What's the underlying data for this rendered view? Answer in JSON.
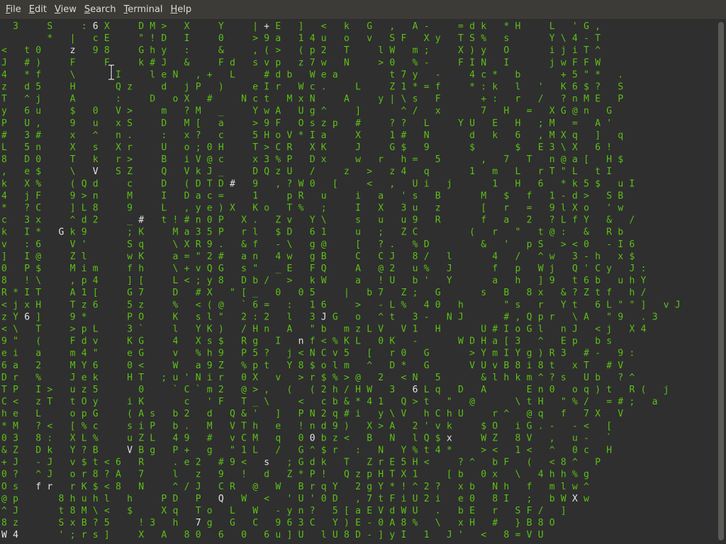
{
  "menu": [
    {
      "label": "File",
      "mnemonic": "F",
      "rest": "ile"
    },
    {
      "label": "Edit",
      "mnemonic": "E",
      "rest": "dit"
    },
    {
      "label": "View",
      "mnemonic": "V",
      "rest": "iew"
    },
    {
      "label": "Search",
      "mnemonic": "S",
      "rest": "earch"
    },
    {
      "label": "Terminal",
      "mnemonic": "T",
      "rest": "erminal"
    },
    {
      "label": "Help",
      "mnemonic": "H",
      "rest": "elp"
    }
  ],
  "colors": {
    "background": "#2f2f2f",
    "menubar": "#3c3b37",
    "menu_text": "#dfdbd2",
    "rain_green": "#5cc016",
    "rain_head": "#e6e6e6"
  },
  "terminal": {
    "program": "matrix rain",
    "rows": [
      "  3     S     : 6 X     D M >   X     Y     | + E   ]   <   k   G   ,   A -     = d k   * H     L   ' G ,  ",
      "        *   |   c E     \" ! D   I     0     > 9 a   1 4 u   o   v   S F   X y   T S %   s       Y \\ 4 - T  ",
      "<   t 0     z   9 8     G h y   :     &     , ( >   ( p 2   T     l W   m ;     X ) y   O       i j i T ^  ",
      "J   # )     F     F     k # J   &     F d   s v p   z 7 w   N     > 0   % -     F I N   I       j w F F W  ",
      "4   * f     \\       I     l e N   , +   L     # d b   W e a         t 7 y   -     4 c *   b       + 5 \" *   . ",
      "z   d 5     H       Q z     d   j P   )     e I r   W c .     L     Z 1 * = f     * : k   l   '   K 6 $ ?   S ",
      "T   ^ j     A       :     D   o X   #     N c t   M x N     A     y | \\ s   F       + :   r   /   ? n M E   P ",
      "y   6 u     $   0   V >     m   ? M   _     Y w A   U g ^     ]       ^ /   x       7   H   =   X G @ n   G ",
      "P   U ,     9   u   x S     D   M [   a     > 9 F   O s z p   #     ? ?   L     Y U   E   H   ; M   =   A ' ",
      "#   3 #     x   ^   n .     :   x ?   c     5 H o V * I a     X     1 #   N       d   k   6   , M X q   ]   q ",
      "L   5 n     X   s   X r     U   o ; 0 H     T > C R   X K     J     G $   9       $       $   E 3 \\ X   6 ! ",
      "8   D 0     T   k   r >     B   i V @ c     x 3 % P   D x     w   r   h =   5       ,   7   T   n @ a [   H $ ",
      ",   e $     \\   V   S Z     Q   V k J _     D Q z U   /     z   >   z 4   q       1   m   L   r T \" L   t I ",
      "k   X %     ( Q d     c     D   ( D T D #   9   , ? W 0   [     <   ,   U i   j       1   H   6   * k 5 $   u I ",
      "4   j F     9 > n     M     I   D a c =     1     p R   u     i   a   ' s   B       M   $   f   1 - d >   S B ",
      "*   ? C     ] L 8     9     L   , y e ) X   K o   T %   ;     I   X   3 u   z       [   r   =   9 l X o   ' w ",
      "c   3 x     ^ d 2     _ #   t ! # n 0 P   X .   Z v   Y \\     s   u   u 9   R       f   a   2   ? L f Y   &   / ",
      "k   I *   G k 9       ; K     M a 3 5 P   r l   $ D   6 1     u   ;   Z C         (   r   \"   t @ :   &   R b ",
      "v   : 6     V '       S q     \\ X R 9 .   & f   - \\   g @     [   ? .   % D         &   '   p S   > < 0   - I 6 ",
      "]   I @     Z l       w K     a = \" 2 #   a n   4 w   g B     C   C J   8 /   l       4   /   ^ w   3 - h   x $ ",
      "0   P $     M i m     f h     \\ + v Q G   s \"   _ E   F Q     A   @ 2   u %   J       f   p   W j   Q ' C y   J : ",
      "8   ! \\     , p 4     ] [     L < ; y 8   D b /   >   k W     a   ! U   b '   Y       a   h   ] 9   t 6 b   u h Y ",
      "R * I T     A 1 [     G 7     D   # X   \" [ _   0   0 5     |   b 7   Z ;   G       s   B   8 x   & ? Z t f   h / ",
      "< j x H     T z 6     5 z     %   < ( @   ` 6 =   :   1 6     >   - L %   4 0   h       \" s   r   Y t   6 L \" \" ]   v J ",
      "z Y 6 ]     9 *       P O     K   s l \"   2 : 2   l   3 J G   o   ^ t   3 -   N J       # , Q p r   \\ A   \" 9   . 3 ",
      "< \\   T     > p L     3 `     l   Y K )   / H n   A   \" b   m z L V   V 1   H       U # I o G l   n J   < j   X 4 ",
      "9 \"   (     F d v     K G     4   X s $   R g   I   n f < % K L   0 K   -       W D H a [ 3   ^   E p   b s ",
      "e i   a     m 4 \"     e G     v   % h 9   P 5 ?   j < N C v 5   [   r 0   G       > Y m I Y g ) R 3   # -   9 : ",
      "6 a   2     M Y 6     0 <     W   a 9 Z   % p t   Y 8 $ o l m   ^   D *   G       V U v B 8 i 8 t   x T   # V ",
      "D r   %     J e k     H T   ; u ' N i r   0 X   v   > r $ % > @   2   < N   5       & l h k m ^ ? s   U b   ? ^ ",
      "T P   I >   u z 5       0     ` C ` m 2   @ > ,   (   ( 2 h / H W   3   6 L q   D   A       E n 0   o q ) t   R (   j ",
      "C <   z T   t O y     i K       c   ' F   T _ \\     <   c b & * 4 1   Q > t   \"   @       \\ t H   \" % /   = # ;   a ",
      "h e   L     o p G     ( A s   b 2   d   Q & '   ]   P N 2 q # i   y \\ V   h C h U     r ^   @ q   f   7 X   V ",
      "* M   ? <   [ % c     s i P   b .   M   V T h   e   ! n d 9 )   X > A   2 ' v k     $ O   i G . -   - <   [ ",
      "0 3   8 :   X L %     u Z L   4 9   #   v C M   q   0 0 b z <   B   N   l Q $ x     W Z   8 V   ,   u -   ` ",
      "& Z   D k   Y ? B     V B g   P +   g   \" 1 L   /   G ^ $ r   :   N   Y % t 4 *     > <   1 <   ^   0 c   H ",
      "+ J   - J   v $ t < 6   R     . e 2   # 9 <   s   ; G d k   T   Z r E 5 H <     ? ^   b F   (   < 8 ^   P ",
      "0 ?   ^ J   o r 8 ? A   7     l   z   9   !   d   Z * P !   Q z p H T X 1     [ b   0 x   \\   4 h h % g ",
      "O s   f r   r K $ < 8   N     ^ / J   C R   @   W   B r q Y   2 g Y * ! ^ 2 ?   x b   N h   f   m l w ^ ",
      "@ p       8 h u h l   h     P D   P   Q   W   <   ' U ' 0 D   , 7 t F i U 2 i   e 0   8 I   ;   b W X w ",
      "^ J       t 8 M \\ <   $     X q   T o   L   W   - y n ?   5 [ a E V d W U   .   b E   r   S F /   ] ",
      "8 z       S x B ? 5     ! 3   h   7 g   G   C   9 6 3 C   Y ) E - 0 A 8 %   \\   x H   #   } B 8 O ",
      "W 4       ' ; r s ]     X   A   8 0   6   0   6 u ] U   l U 8 D - ] y I   1   J '   <   8 = V U "
    ],
    "highlighted": [
      [
        0,
        16,
        "6"
      ],
      [
        0,
        66,
        "H"
      ],
      [
        0,
        46,
        "G"
      ],
      [
        1,
        53,
        "v"
      ],
      [
        2,
        12,
        "9"
      ],
      [
        3,
        41,
        "d"
      ],
      [
        3,
        59,
        "N"
      ],
      [
        4,
        22,
        "l"
      ],
      [
        4,
        24,
        "e"
      ],
      [
        5,
        85,
        "*"
      ],
      [
        6,
        61,
        "y"
      ],
      [
        8,
        71,
        "Y"
      ],
      [
        9,
        43,
        "*"
      ],
      [
        11,
        57,
        "x"
      ],
      [
        12,
        16,
        "S"
      ],
      [
        13,
        40,
        ","
      ],
      [
        13,
        42,
        "?"
      ],
      [
        16,
        24,
        "t"
      ],
      [
        16,
        67,
        "R"
      ],
      [
        16,
        109,
        "?"
      ],
      [
        17,
        10,
        "G"
      ],
      [
        21,
        26,
        "<"
      ],
      [
        24,
        4,
        "6"
      ],
      [
        24,
        56,
        "3"
      ],
      [
        25,
        77,
        "V"
      ],
      [
        26,
        52,
        "I"
      ],
      [
        27,
        99,
        ">"
      ],
      [
        29,
        109,
        "k"
      ],
      [
        30,
        72,
        "3"
      ],
      [
        30,
        114,
        ")"
      ],
      [
        31,
        40,
        "F"
      ],
      [
        31,
        101,
        "H"
      ],
      [
        32,
        122,
        "V"
      ],
      [
        33,
        62,
        "!"
      ],
      [
        33,
        70,
        "X"
      ],
      [
        34,
        54,
        "q"
      ],
      [
        34,
        78,
        "B"
      ],
      [
        35,
        22,
        "g"
      ],
      [
        35,
        20,
        "V"
      ],
      [
        36,
        46,
        "9"
      ],
      [
        37,
        108,
        "4"
      ],
      [
        37,
        106,
        "\\"
      ],
      [
        38,
        6,
        "f"
      ],
      [
        38,
        8,
        "r"
      ],
      [
        39,
        38,
        "D"
      ],
      [
        39,
        100,
        "0"
      ],
      [
        40,
        24,
        "$"
      ],
      [
        41,
        34,
        "3"
      ],
      [
        42,
        0,
        "W"
      ],
      [
        42,
        2,
        "4"
      ],
      [
        42,
        105,
        "J"
      ]
    ]
  }
}
